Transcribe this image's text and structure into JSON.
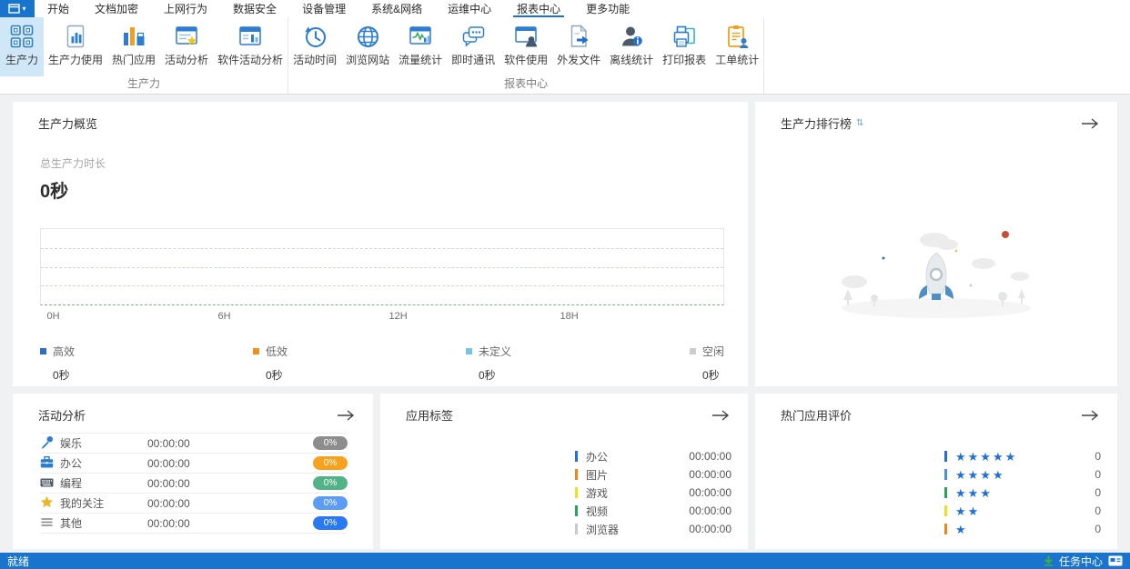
{
  "window": {
    "tabs": [
      {
        "label": "开始"
      },
      {
        "label": "文档加密"
      },
      {
        "label": "上网行为"
      },
      {
        "label": "数据安全"
      },
      {
        "label": "设备管理"
      },
      {
        "label": "系统&网络"
      },
      {
        "label": "运维中心"
      },
      {
        "label": "报表中心",
        "active": true
      },
      {
        "label": "更多功能"
      }
    ],
    "app_button_caret": "▾"
  },
  "ribbon": {
    "groups": [
      {
        "label": "生产力",
        "items": [
          {
            "label": "生产力",
            "icon": "productivity-grid-icon",
            "selected": true
          },
          {
            "label": "生产力使用",
            "icon": "doc-chart-icon"
          },
          {
            "label": "热门应用",
            "icon": "bar-chart-icon"
          },
          {
            "label": "活动分析",
            "icon": "window-star-icon"
          },
          {
            "label": "软件活动分析",
            "icon": "window-chart-icon"
          }
        ]
      },
      {
        "label": "报表中心",
        "items": [
          {
            "label": "活动时间",
            "icon": "history-clock-icon"
          },
          {
            "label": "浏览网站",
            "icon": "globe-icon"
          },
          {
            "label": "流量统计",
            "icon": "traffic-chart-icon"
          },
          {
            "label": "即时通讯",
            "icon": "chat-icon"
          },
          {
            "label": "软件使用",
            "icon": "window-user-icon"
          },
          {
            "label": "外发文件",
            "icon": "file-send-icon"
          },
          {
            "label": "离线统计",
            "icon": "user-info-icon"
          },
          {
            "label": "打印报表",
            "icon": "printer-icon"
          },
          {
            "label": "工单统计",
            "icon": "clipboard-user-icon"
          }
        ]
      }
    ]
  },
  "overview": {
    "title": "生产力概览",
    "total_label": "总生产力时长",
    "total_value": "0秒",
    "x_ticks": [
      "0H",
      "6H",
      "12H",
      "18H"
    ],
    "legend": [
      {
        "label": "高效",
        "value": "0秒",
        "color": "#2f6fc3"
      },
      {
        "label": "低效",
        "value": "0秒",
        "color": "#f08f1e"
      },
      {
        "label": "未定义",
        "value": "0秒",
        "color": "#74c4e8"
      },
      {
        "label": "空闲",
        "value": "0秒",
        "color": "#cccccc"
      }
    ]
  },
  "chart_data": {
    "type": "area",
    "title": "生产力概览",
    "x_ticks": [
      "0H",
      "6H",
      "12H",
      "18H"
    ],
    "x_range_hours": [
      0,
      24
    ],
    "grid": "dashed-horizontal",
    "legend_position": "bottom",
    "series": [
      {
        "name": "高效",
        "color": "#2f6fc3",
        "total": "0秒",
        "values": [
          0,
          0,
          0,
          0
        ]
      },
      {
        "name": "低效",
        "color": "#f08f1e",
        "total": "0秒",
        "values": [
          0,
          0,
          0,
          0
        ]
      },
      {
        "name": "未定义",
        "color": "#74c4e8",
        "total": "0秒",
        "values": [
          0,
          0,
          0,
          0
        ]
      },
      {
        "name": "空闲",
        "color": "#cccccc",
        "total": "0秒",
        "values": [
          0,
          0,
          0,
          0
        ]
      }
    ]
  },
  "ranking": {
    "title": "生产力排行榜"
  },
  "activity": {
    "title": "活动分析",
    "rows": [
      {
        "icon": "microphone-icon",
        "label": "娱乐",
        "time": "00:00:00",
        "percent": "0%",
        "color": "#8d8d8d"
      },
      {
        "icon": "briefcase-icon",
        "label": "办公",
        "time": "00:00:00",
        "percent": "0%",
        "color": "#f7a21c"
      },
      {
        "icon": "keyboard-icon",
        "label": "编程",
        "time": "00:00:00",
        "percent": "0%",
        "color": "#53b287"
      },
      {
        "icon": "star-icon",
        "label": "我的关注",
        "time": "00:00:00",
        "percent": "0%",
        "color": "#5b9cf5"
      },
      {
        "icon": "list-icon",
        "label": "其他",
        "time": "00:00:00",
        "percent": "0%",
        "color": "#2979f2"
      }
    ]
  },
  "app_tags": {
    "title": "应用标签",
    "rows": [
      {
        "label": "办公",
        "time": "00:00:00",
        "color": "#1f6fe0"
      },
      {
        "label": "图片",
        "time": "00:00:00",
        "color": "#f08519"
      },
      {
        "label": "游戏",
        "time": "00:00:00",
        "color": "#f0e01c"
      },
      {
        "label": "视频",
        "time": "00:00:00",
        "color": "#2aa35c"
      },
      {
        "label": "浏览器",
        "time": "00:00:00",
        "color": "#c9c9c9"
      }
    ]
  },
  "ratings": {
    "title": "热门应用评价",
    "rows": [
      {
        "stars": "★★★★★",
        "count": "0",
        "color": "#1f6fe0"
      },
      {
        "stars": "★★★★",
        "count": "0",
        "color": "#4a90dd"
      },
      {
        "stars": "★★★",
        "count": "0",
        "color": "#2aa35c"
      },
      {
        "stars": "★★",
        "count": "0",
        "color": "#f0e01c"
      },
      {
        "stars": "★",
        "count": "0",
        "color": "#f08519"
      }
    ]
  },
  "statusbar": {
    "left": "就绪",
    "task_center": "任务中心"
  },
  "colors": {
    "accent_blue": "#1874cd",
    "selected_tool_bg": "#cfe7f7",
    "statusbar_bg": "#1874cd",
    "chart_axis_green": "#74b874",
    "star_blue": "#1f6fe0"
  }
}
